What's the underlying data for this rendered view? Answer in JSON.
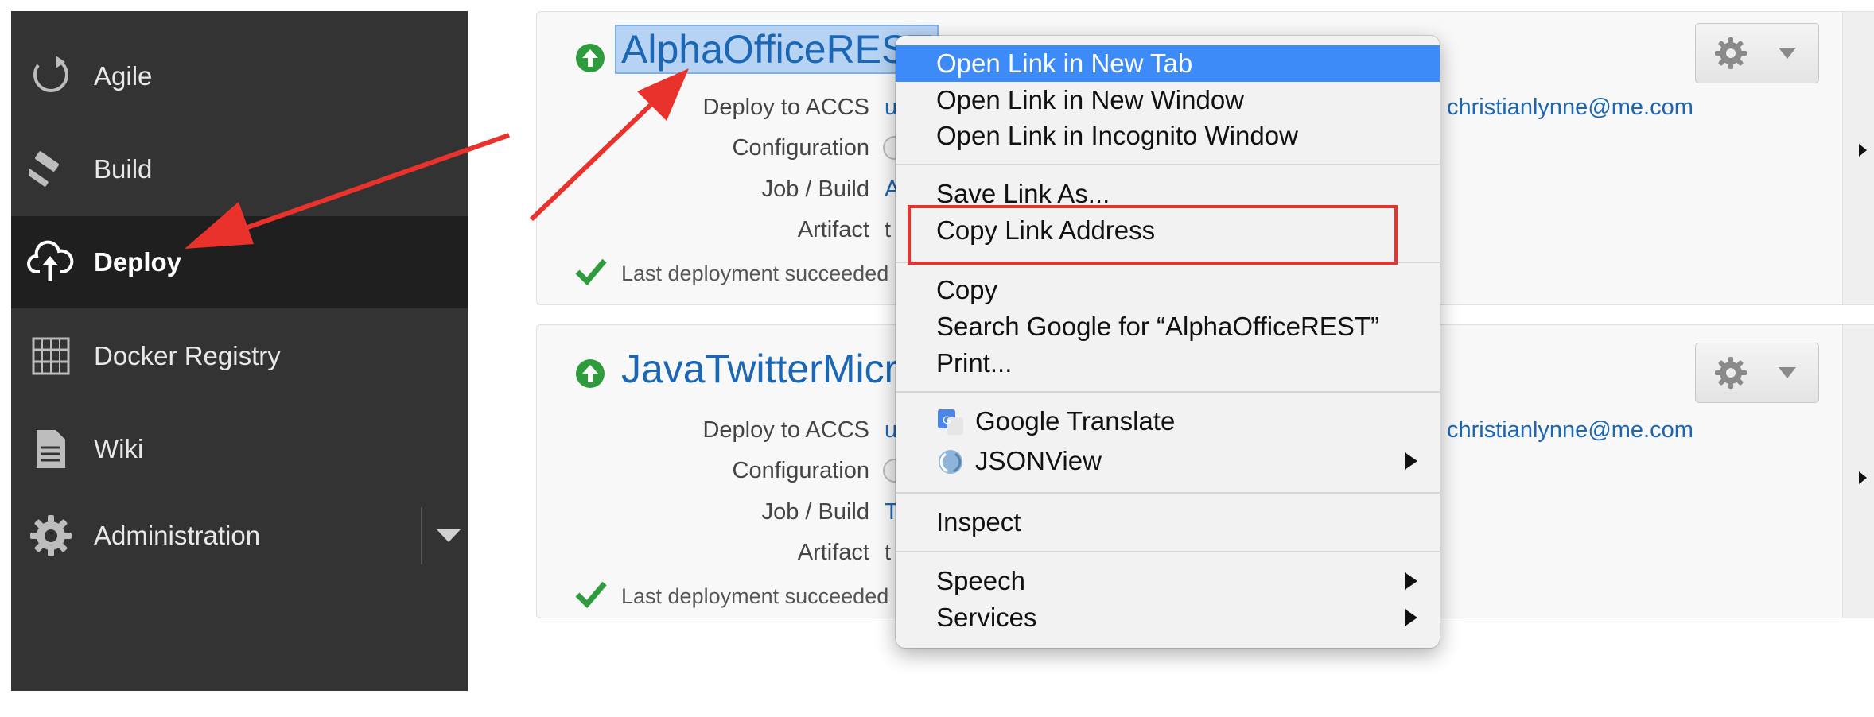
{
  "sidebar": {
    "items": [
      {
        "label": "Agile",
        "icon": "agile-icon"
      },
      {
        "label": "Build",
        "icon": "hammer-icon"
      },
      {
        "label": "Deploy",
        "icon": "cloud-upload-icon",
        "active": true
      },
      {
        "label": "Docker Registry",
        "icon": "docker-registry-icon"
      },
      {
        "label": "Wiki",
        "icon": "document-icon"
      },
      {
        "label": "Administration",
        "icon": "gear-icon"
      }
    ]
  },
  "deployments": [
    {
      "title": "AlphaOfficeREST",
      "fields": [
        {
          "label": "Deploy to ACCS",
          "value": "u"
        },
        {
          "label": "Configuration",
          "value": ""
        },
        {
          "label": "Job / Build",
          "value": "A"
        },
        {
          "label": "Artifact",
          "value": "t"
        }
      ],
      "owner_email": "christianlynne@me.com",
      "last_status": "Last deployment succeeded"
    },
    {
      "title": "JavaTwitterMicr",
      "fields": [
        {
          "label": "Deploy to ACCS",
          "value": "u"
        },
        {
          "label": "Configuration",
          "value": ""
        },
        {
          "label": "Job / Build",
          "value": "T"
        },
        {
          "label": "Artifact",
          "value": "t"
        }
      ],
      "owner_email": "christianlynne@me.com",
      "last_status": "Last deployment succeeded"
    }
  ],
  "context_menu": {
    "groups": [
      [
        "Open Link in New Tab",
        "Open Link in New Window",
        "Open Link in Incognito Window"
      ],
      [
        "Save Link As...",
        "Copy Link Address"
      ],
      [
        "Copy",
        "Search Google for “AlphaOfficeREST”",
        "Print..."
      ],
      [
        "Google Translate",
        "JSONView"
      ],
      [
        "Inspect"
      ],
      [
        "Speech",
        "Services"
      ]
    ],
    "highlighted": "Open Link in New Tab",
    "annotated": "Copy Link Address"
  },
  "colors": {
    "sidebar_bg": "#333333",
    "sidebar_active_bg": "#1f1f1f",
    "link_blue": "#1b67b5",
    "menu_highlight": "#3d8bf8",
    "annotation_red": "#e8322b",
    "success_green": "#2e9c3c"
  }
}
